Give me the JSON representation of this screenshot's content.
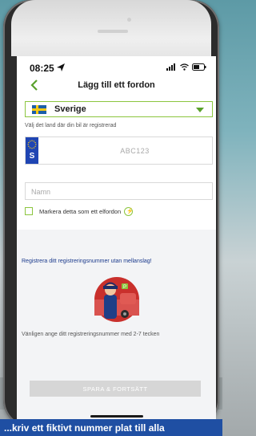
{
  "status_bar": {
    "time": "08:25"
  },
  "header": {
    "title": "Lägg till ett fordon"
  },
  "country": {
    "selected": "Sverige",
    "hint": "Välj det land där din bil är registrerad"
  },
  "plate": {
    "eu_code": "S",
    "placeholder": "ABC123"
  },
  "name_field": {
    "placeholder": "Namn"
  },
  "electric": {
    "label": "Markera detta som ett elfordon"
  },
  "info": {
    "title": "Registrera ditt registreringsnummer utan mellanslag!",
    "instruction": "Vänligen ange ditt registreringsnummer med 2-7 tecken"
  },
  "actions": {
    "save_label": "SPARA & FORTSÄTT"
  },
  "banner": {
    "text": "...kriv ett fiktivt nummer plat till alla"
  },
  "colors": {
    "accent_green": "#8cc63f",
    "banner_blue": "#1f4fa3",
    "button_disabled": "#d6d6d6"
  }
}
